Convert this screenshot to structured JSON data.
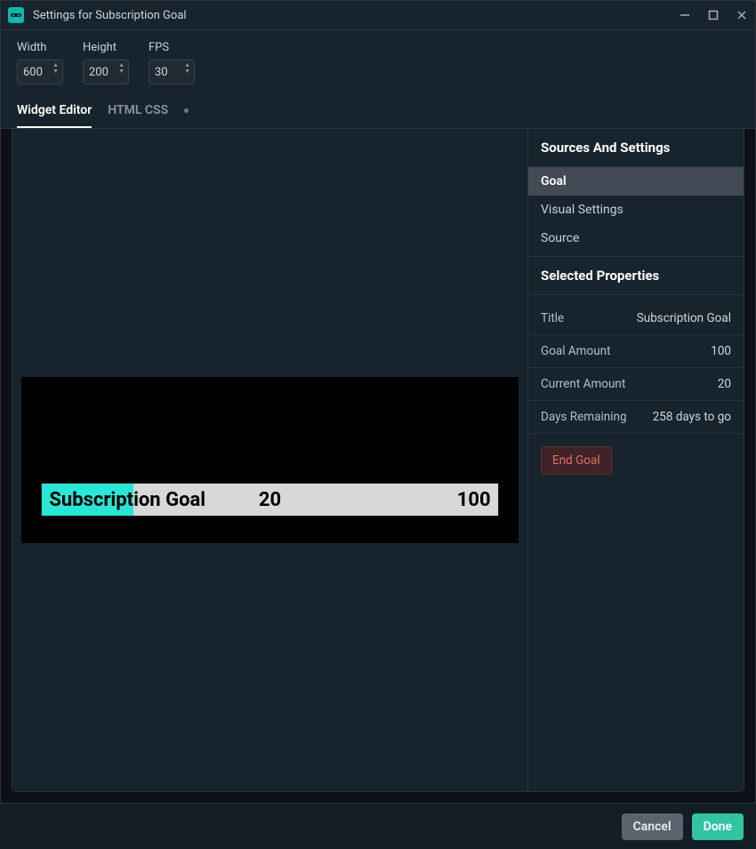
{
  "window": {
    "title": "Settings for Subscription Goal"
  },
  "dimensions": {
    "width": {
      "label": "Width",
      "value": "600"
    },
    "height": {
      "label": "Height",
      "value": "200"
    },
    "fps": {
      "label": "FPS",
      "value": "30"
    }
  },
  "tabs": {
    "widget_editor": "Widget Editor",
    "html_css": "HTML CSS"
  },
  "goal_bar": {
    "title": "Subscription Goal",
    "current": "20",
    "total": "100",
    "fill_percent": 20,
    "fill_color": "#2ae6d6",
    "track_color": "#d8d8d8"
  },
  "right_panel": {
    "sources_heading": "Sources And Settings",
    "items": {
      "goal": "Goal",
      "visual": "Visual Settings",
      "source": "Source"
    },
    "selected_heading": "Selected Properties",
    "props": {
      "title": {
        "label": "Title",
        "value": "Subscription Goal"
      },
      "goal_amount": {
        "label": "Goal Amount",
        "value": "100"
      },
      "current_amount": {
        "label": "Current Amount",
        "value": "20"
      },
      "days_remaining": {
        "label": "Days Remaining",
        "value": "258 days to go"
      }
    },
    "end_goal": "End Goal"
  },
  "footer": {
    "cancel": "Cancel",
    "done": "Done"
  }
}
